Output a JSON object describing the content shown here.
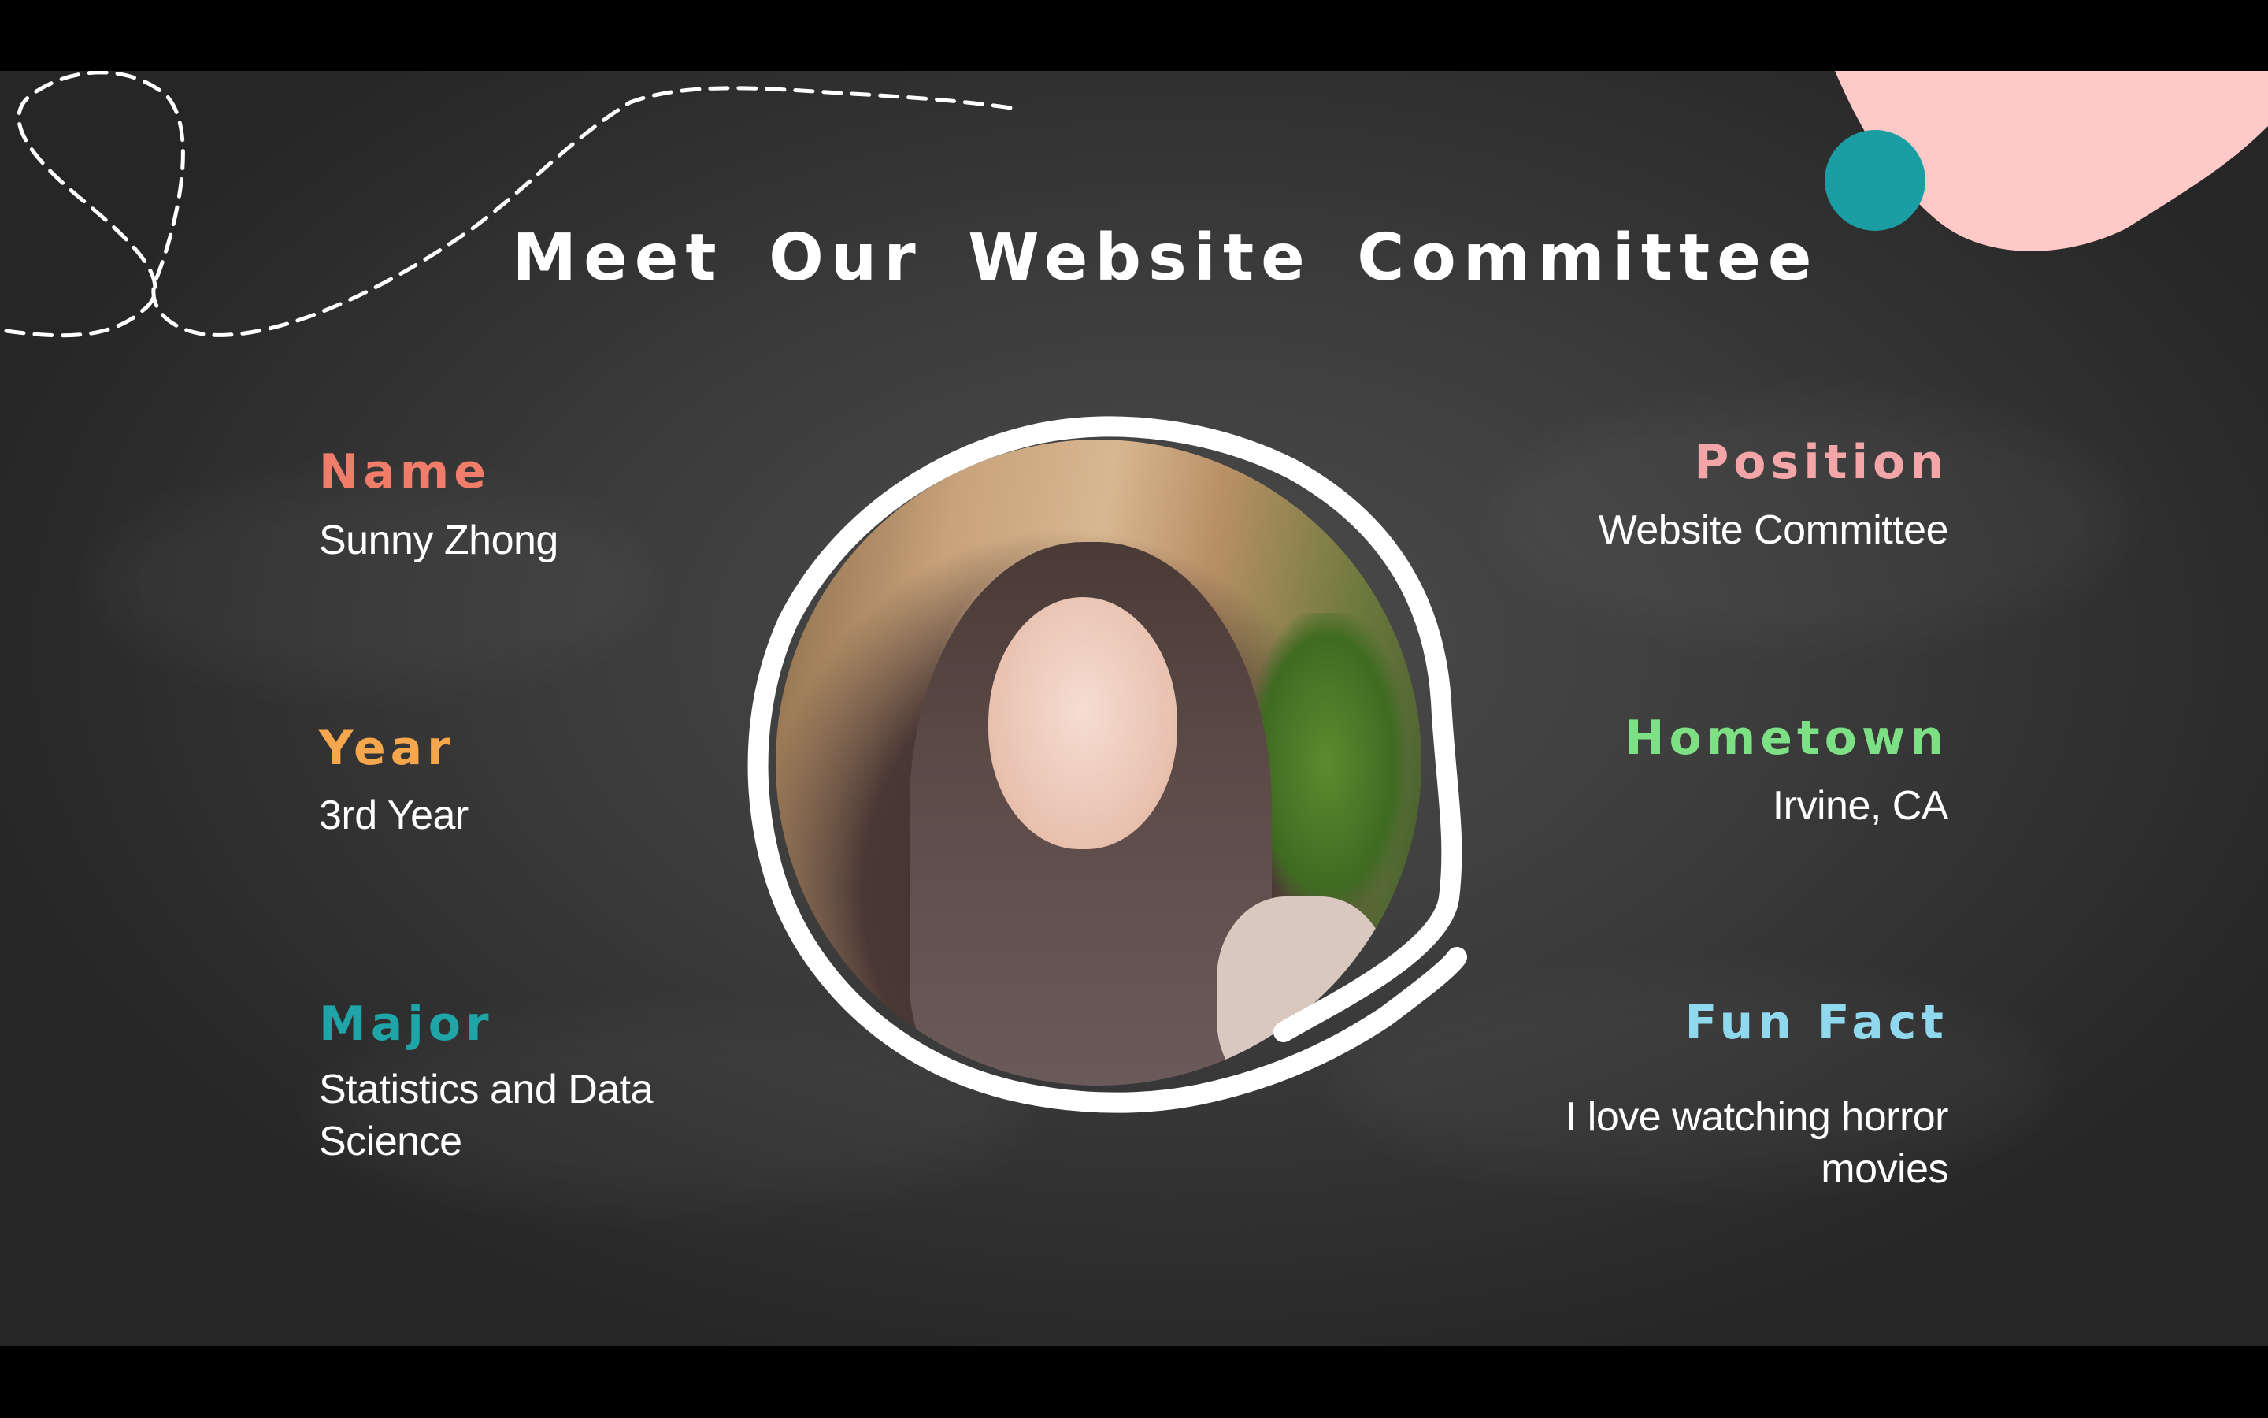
{
  "slide": {
    "title": "Meet Our Website Committee",
    "fields": {
      "name": {
        "label": "Name",
        "value": "Sunny Zhong",
        "color": "#f07c6a"
      },
      "year": {
        "label": "Year",
        "value": "3rd Year",
        "color": "#f6a64c"
      },
      "major": {
        "label": "Major",
        "value_line1": "Statistics and Data",
        "value_line2": "Science",
        "color": "#1fa5a8"
      },
      "position": {
        "label": "Position",
        "value": "Website Committee",
        "color": "#f4a5a8"
      },
      "hometown": {
        "label": "Hometown",
        "value": "Irvine, CA",
        "color": "#7ee084"
      },
      "fun_fact": {
        "label": "Fun Fact",
        "value_line1": "I love watching horror",
        "value_line2": "movies",
        "color": "#8fd8ee"
      }
    },
    "colors": {
      "pink_blob": "#ffc9c7",
      "teal_dot": "#1b9ea3",
      "background": "#3d3d3d",
      "letterbox": "#000000"
    }
  }
}
